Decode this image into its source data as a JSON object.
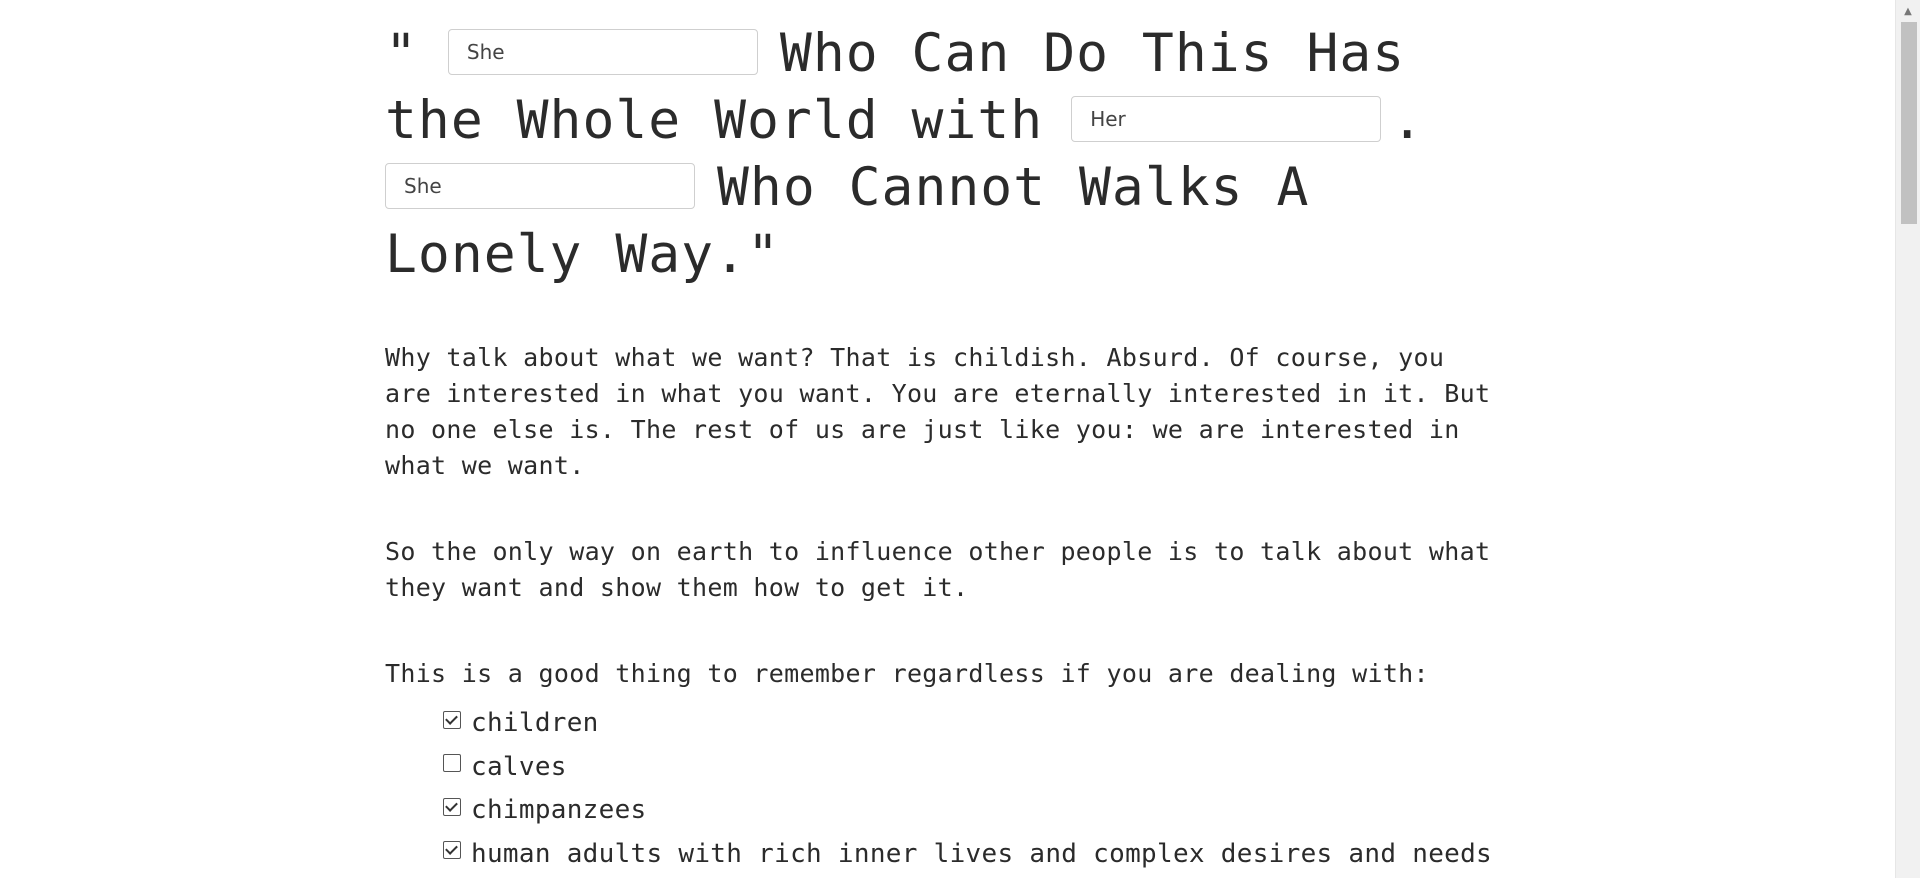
{
  "headline": {
    "open_quote": "\"",
    "input1_value": "She",
    "part1": "Who Can Do This Has the Whole World with",
    "input2_value": "Her",
    "period": ".",
    "input3_value": "She",
    "part2": "Who Cannot Walks A Lonely Way.\""
  },
  "paragraphs": {
    "p1": "Why talk about what we want? That is childish. Absurd. Of course, you are interested in what you want. You are eternally interested in it. But no one else is. The rest of us are just like you: we are interested in what we want.",
    "p2": "So the only way on earth to influence other people is to talk about what they want and show them how to get it.",
    "p3": "This is a good thing to remember regardless if you are dealing with:"
  },
  "checklist": [
    {
      "label": "children",
      "checked": true
    },
    {
      "label": "calves",
      "checked": false
    },
    {
      "label": "chimpanzees",
      "checked": true
    },
    {
      "label": "human adults with rich inner lives and complex desires and needs",
      "checked": true
    }
  ],
  "scrollbar": {
    "up_arrow_icon": "chevron-up-icon"
  }
}
